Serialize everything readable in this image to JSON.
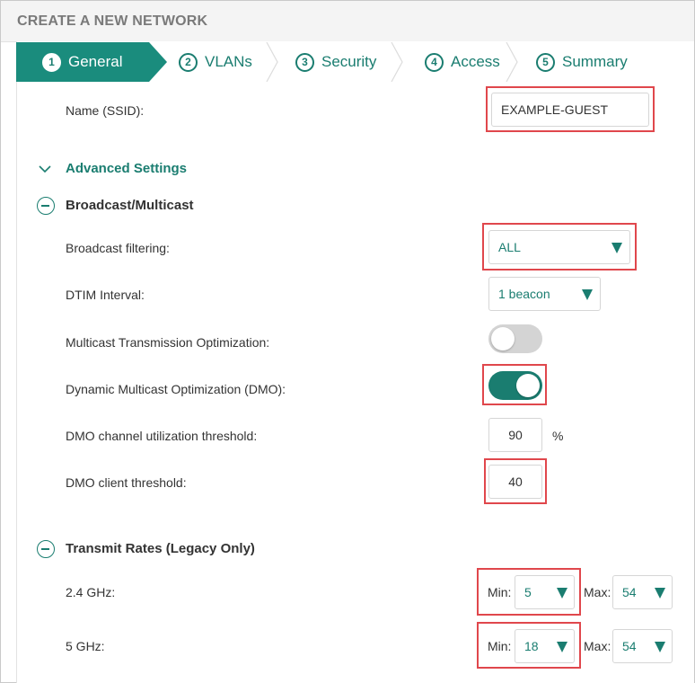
{
  "page": {
    "title": "CREATE A NEW NETWORK"
  },
  "wizard": {
    "steps": [
      {
        "num": "1",
        "label": "General",
        "active": true
      },
      {
        "num": "2",
        "label": "VLANs",
        "active": false
      },
      {
        "num": "3",
        "label": "Security",
        "active": false
      },
      {
        "num": "4",
        "label": "Access",
        "active": false
      },
      {
        "num": "5",
        "label": "Summary",
        "active": false
      }
    ]
  },
  "general": {
    "ssid_label": "Name (SSID):",
    "ssid_value": "EXAMPLE-GUEST"
  },
  "advanced": {
    "title": "Advanced Settings"
  },
  "broadcast": {
    "title": "Broadcast/Multicast",
    "filtering_label": "Broadcast filtering:",
    "filtering_value": "ALL",
    "dtim_label": "DTIM Interval:",
    "dtim_value": "1 beacon",
    "mto_label": "Multicast Transmission Optimization:",
    "mto_enabled": false,
    "dmo_label": "Dynamic Multicast Optimization (DMO):",
    "dmo_enabled": true,
    "dmo_util_label": "DMO channel utilization threshold:",
    "dmo_util_value": "90",
    "dmo_util_unit": "%",
    "dmo_client_label": "DMO client threshold:",
    "dmo_client_value": "40"
  },
  "transmit": {
    "title": "Transmit Rates (Legacy Only)",
    "min_label": "Min:",
    "max_label": "Max:",
    "band24_label": "2.4 GHz:",
    "band24_min": "5",
    "band24_max": "54",
    "band5_label": "5 GHz:",
    "band5_min": "18",
    "band5_max": "54"
  },
  "colors": {
    "accent": "#1a7d70",
    "highlight": "#e0474c",
    "toggle_off": "#d4d4d4"
  }
}
